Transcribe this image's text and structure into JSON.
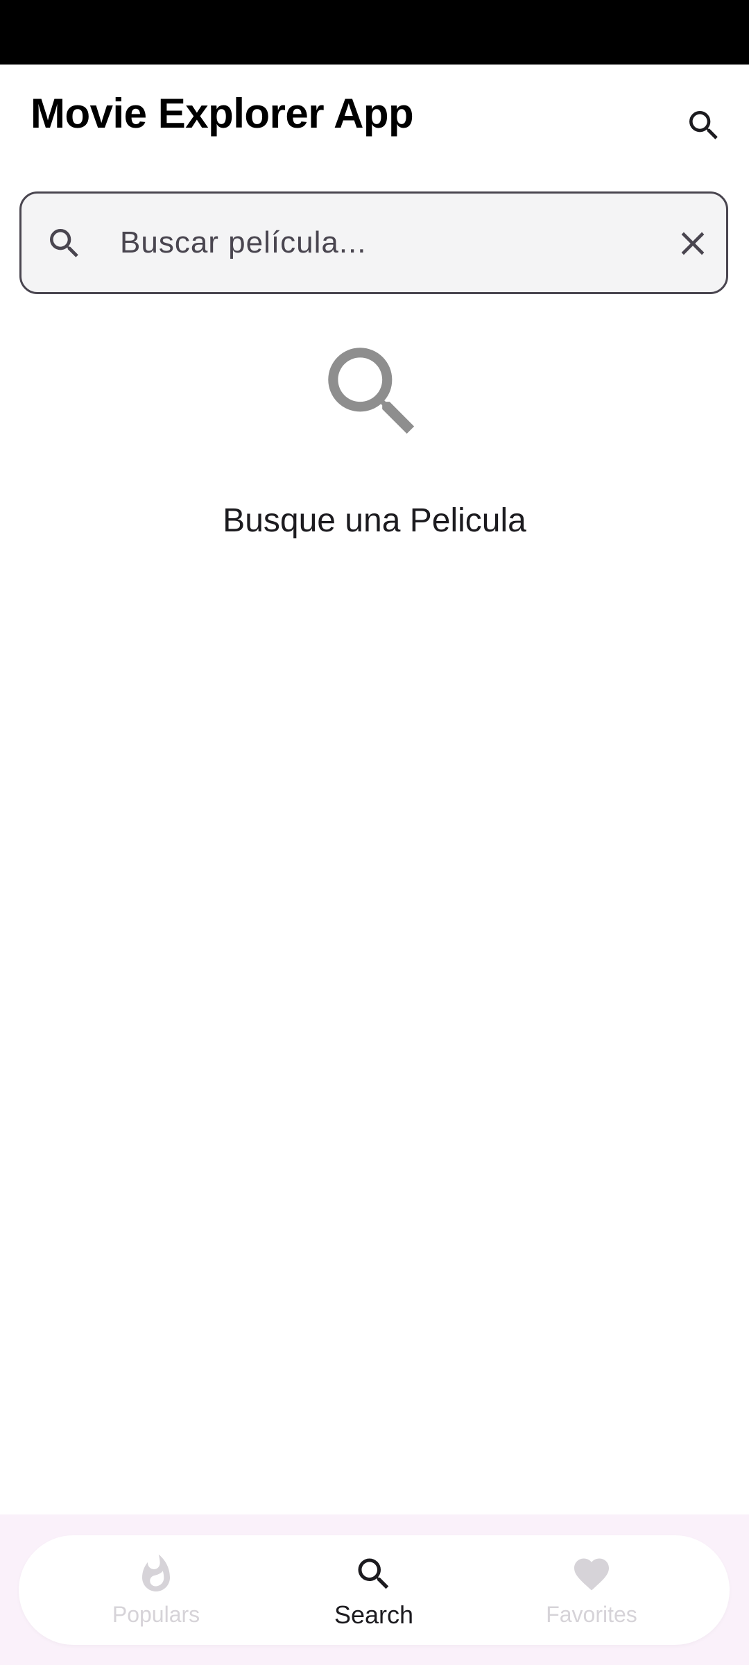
{
  "app_bar": {
    "title": "Movie Explorer App",
    "action_icon": "search-icon"
  },
  "search": {
    "leading_icon": "search-icon",
    "placeholder": "Buscar película...",
    "value": "",
    "clear_icon": "close-icon"
  },
  "empty_state": {
    "icon": "search-icon",
    "message": "Busque una Pelicula"
  },
  "bottom_nav": {
    "items": [
      {
        "label": "Populars",
        "icon": "flame-icon",
        "active": false
      },
      {
        "label": "Search",
        "icon": "search-icon",
        "active": true
      },
      {
        "label": "Favorites",
        "icon": "heart-icon",
        "active": false
      }
    ]
  },
  "colors": {
    "status_bar": "#000000",
    "field_border": "#49454f",
    "field_bg": "#f4f4f5",
    "empty_icon": "#8e8e8e",
    "nav_active": "#1c1b1f",
    "nav_inactive": "#d6d3d8",
    "nav_bg": "#faf1fa"
  }
}
